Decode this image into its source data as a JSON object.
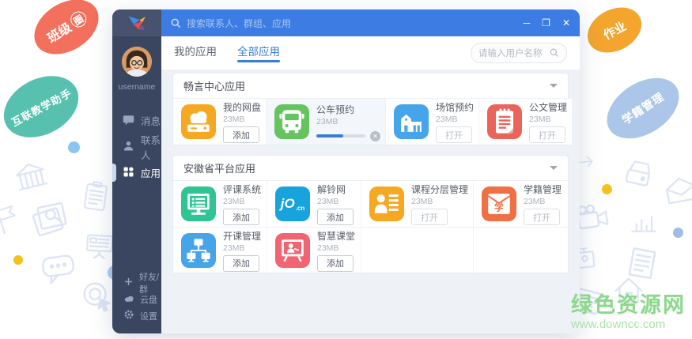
{
  "colors": {
    "accent": "#3a7bd5",
    "topbar": "#3d7ce2",
    "sidebar": "#3a4560",
    "watermark_green": "#8bd88b"
  },
  "decor": {
    "bubbles": {
      "class_circle": {
        "text": "班级",
        "circled": "圈",
        "color": "#f2705c"
      },
      "homework": {
        "text": "作业",
        "color": "#f3a52e"
      },
      "assistant": {
        "text": "互联教学助手",
        "color": "#57c0ae"
      },
      "student_mgmt": {
        "text": "学籍管理",
        "color": "#abc6e8"
      }
    },
    "background_icon_names": [
      "bank-icon",
      "clipboard-icon",
      "photo-search-icon",
      "flag-icon",
      "presentation-icon",
      "chat-dots-icon",
      "target-click-icon",
      "arrow-right-icon",
      "disk-drive-icon",
      "open-envelope-icon",
      "video-camera-icon",
      "bar-chart-icon",
      "pin-badge-icon",
      "newspaper-icon",
      "house-icon",
      "id-card-icon"
    ],
    "watermark": {
      "title": "绿色资源网",
      "url": "www.downcc.com"
    }
  },
  "window": {
    "topbar": {
      "search_placeholder": "搜索联系人、群组、应用",
      "controls": {
        "minimize": "─",
        "maximize": "❐",
        "close": "✕"
      }
    },
    "sidebar": {
      "username": "username",
      "items": [
        {
          "label": "消息",
          "icon": "message-icon",
          "active": false
        },
        {
          "label": "联系人",
          "icon": "contacts-icon",
          "active": false
        },
        {
          "label": "应用",
          "icon": "apps-grid-icon",
          "active": true
        }
      ],
      "footer_items": [
        {
          "label": "好友/群",
          "icon": "plus-icon"
        },
        {
          "label": "云盘",
          "icon": "cloud-icon"
        },
        {
          "label": "设置",
          "icon": "gear-icon"
        }
      ]
    },
    "tabs": [
      {
        "label": "我的应用",
        "active": false
      },
      {
        "label": "全部应用",
        "active": true
      }
    ],
    "user_search_placeholder": "请输入用户名称",
    "sections": [
      {
        "title": "畅言中心应用",
        "apps": [
          {
            "name": "我的网盘",
            "size": "23MB",
            "action_type": "add",
            "action_label": "添加",
            "icon": "netdisk-icon",
            "color": "#f7a823"
          },
          {
            "name": "公车预约",
            "size": "23MB",
            "action_type": "downloading",
            "progress": 55,
            "icon": "bus-icon",
            "color": "#65c45f"
          },
          {
            "name": "场馆预约",
            "size": "23MB",
            "action_type": "open",
            "action_label": "打开",
            "icon": "venue-icon",
            "color": "#46a4e9"
          },
          {
            "name": "公文管理",
            "size": "23MB",
            "action_type": "open",
            "action_label": "打开",
            "icon": "document-icon",
            "color": "#e9655c"
          }
        ]
      },
      {
        "title": "安徽省平台应用",
        "apps": [
          {
            "name": "评课系统",
            "size": "23MB",
            "action_type": "add",
            "action_label": "添加",
            "icon": "monitor-icon",
            "color": "#2ec593"
          },
          {
            "name": "解铃网",
            "size": "23MB",
            "action_type": "add",
            "action_label": "添加",
            "icon": "jocn-logo-icon",
            "color": "#18a3dc",
            "logo_text": "jO",
            "logo_suffix": ".cn"
          },
          {
            "name": "课程分层管理",
            "size": "23MB",
            "action_type": "open",
            "action_label": "打开",
            "icon": "course-layers-icon",
            "color": "#f7a823"
          },
          {
            "name": "学籍管理",
            "size": "23MB",
            "action_type": "open",
            "action_label": "打开",
            "icon": "envelope-xue-icon",
            "color": "#f07046",
            "glyph": "学"
          },
          {
            "name": "开课管理",
            "size": "23MB",
            "action_type": "add",
            "action_label": "添加",
            "icon": "network-icon",
            "color": "#46a4e9"
          },
          {
            "name": "智慧课堂",
            "size": "23MB",
            "action_type": "add",
            "action_label": "添加",
            "icon": "whiteboard-icon",
            "color": "#f26471"
          }
        ]
      }
    ]
  }
}
